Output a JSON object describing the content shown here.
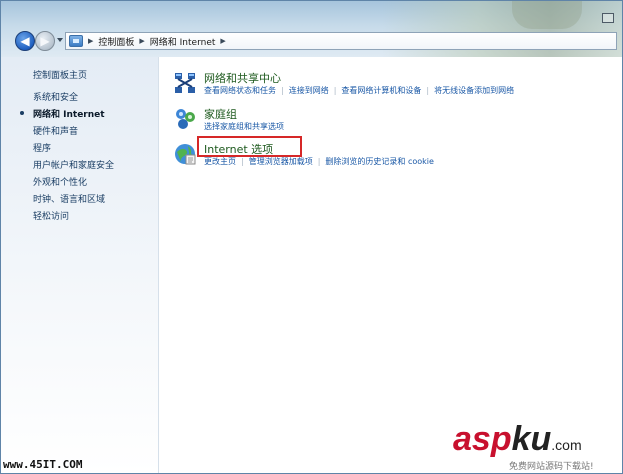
{
  "breadcrumb": {
    "segments": [
      "控制面板",
      "网络和 Internet"
    ]
  },
  "sidebar": {
    "items": [
      {
        "label": "控制面板主页",
        "active": false
      },
      {
        "label": "系统和安全",
        "active": false
      },
      {
        "label": "网络和 Internet",
        "active": true
      },
      {
        "label": "硬件和声音",
        "active": false
      },
      {
        "label": "程序",
        "active": false
      },
      {
        "label": "用户帐户和家庭安全",
        "active": false
      },
      {
        "label": "外观和个性化",
        "active": false
      },
      {
        "label": "时钟、语言和区域",
        "active": false
      },
      {
        "label": "轻松访问",
        "active": false
      }
    ]
  },
  "categories": [
    {
      "title": "网络和共享中心",
      "icon": "network-sharing-icon",
      "links": [
        "查看网络状态和任务",
        "连接到网络",
        "查看网络计算机和设备",
        "将无线设备添加到网络"
      ]
    },
    {
      "title": "家庭组",
      "icon": "homegroup-icon",
      "links": [
        "选择家庭组和共享选项"
      ]
    },
    {
      "title": "Internet 选项",
      "icon": "internet-options-icon",
      "links": [
        "更改主页",
        "管理浏览器加载项",
        "删除浏览的历史记录和 cookie"
      ]
    }
  ],
  "highlight_color": "#d62828",
  "watermarks": {
    "left_text": "www.45IT.COM",
    "logo_asp": "asp",
    "logo_ku": "ku",
    "logo_com": ".com",
    "sub_text": "免费网站源码下载站!"
  }
}
